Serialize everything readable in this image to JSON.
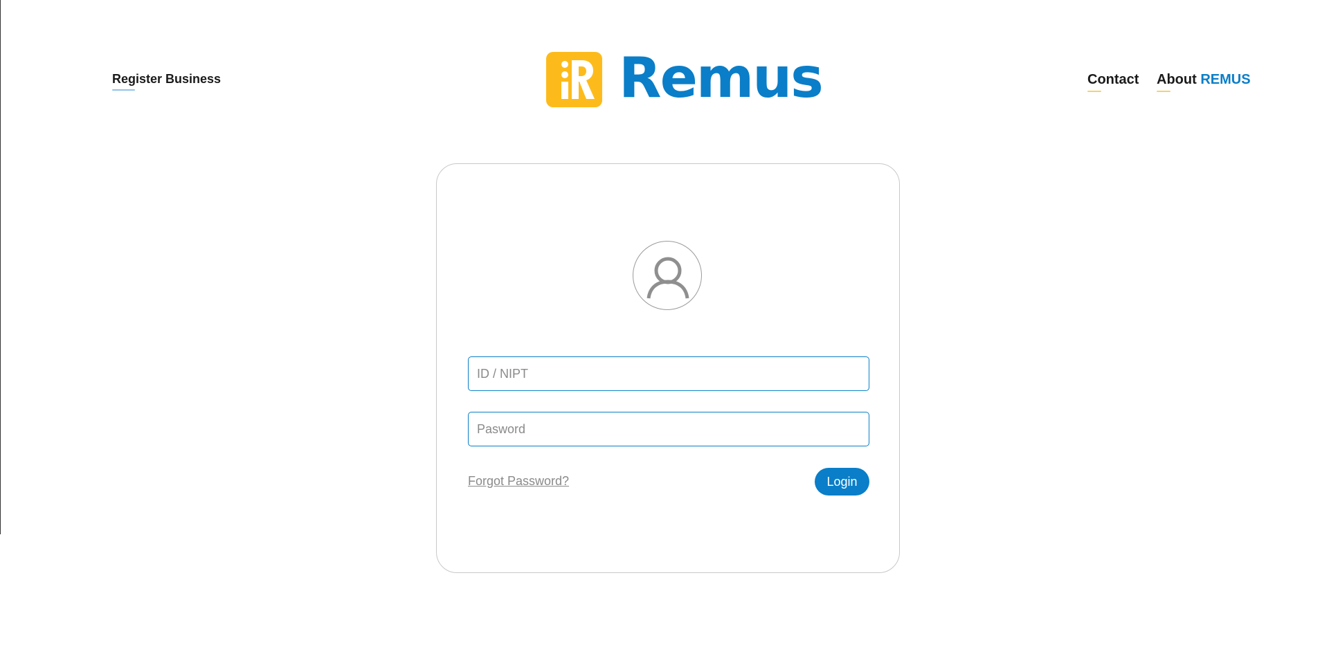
{
  "header": {
    "register_label": "Register Business",
    "contact_label": "Contact",
    "about_prefix": "About",
    "about_accent": "REMUS",
    "brand_name": "Remus"
  },
  "login": {
    "id_placeholder": "ID / NIPT",
    "password_placeholder": "Pasword",
    "forgot_label": "Forgot Password?",
    "login_label": "Login"
  },
  "icons": {
    "brand_logo": "remus-r-logo-icon",
    "avatar": "user-icon"
  },
  "colors": {
    "brand_blue": "#0a7ec8",
    "brand_yellow": "#fdbb1b",
    "text_dark": "#1a1a1a",
    "muted_gray": "#8a8a8a"
  }
}
